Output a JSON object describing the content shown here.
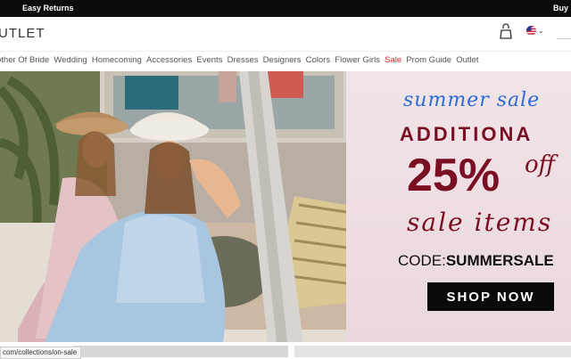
{
  "topbar": {
    "left_text": "Easy Returns",
    "right_text": "Buy n"
  },
  "header": {
    "logo_text": "UTLET"
  },
  "nav": {
    "items": [
      "other Of Bride",
      "Wedding",
      "Homecoming",
      "Accessories",
      "Events",
      "Dresses",
      "Designers",
      "Colors",
      "Flower Girls",
      "Sale",
      "Prom Guide",
      "Outlet"
    ]
  },
  "promo": {
    "eyebrow": "summer sale",
    "headline": "ADDITIONA",
    "percent": "25%",
    "off": "off",
    "items_text": "sale items",
    "code_label": "CODE:",
    "code_value": "SUMMERSALE",
    "cta": "SHOP NOW"
  },
  "status_url": "com/collections/on-sale",
  "colors": {
    "accent_red": "#d71f2b",
    "promo_burgundy": "#7a0f24",
    "promo_blue": "#2b6bd6"
  }
}
